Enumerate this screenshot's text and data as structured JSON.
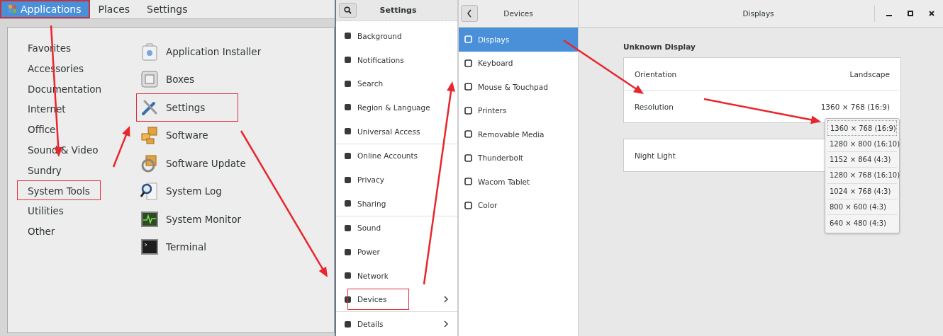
{
  "top_bar": {
    "menus": [
      {
        "label": "Applications",
        "selected": true,
        "highlighted": true
      },
      {
        "label": "Places",
        "selected": false,
        "highlighted": false
      },
      {
        "label": "Settings",
        "selected": false,
        "highlighted": false
      }
    ]
  },
  "app_menu": {
    "categories": [
      {
        "label": "Favorites",
        "highlighted": false
      },
      {
        "label": "Accessories",
        "highlighted": false
      },
      {
        "label": "Documentation",
        "highlighted": false
      },
      {
        "label": "Internet",
        "highlighted": false
      },
      {
        "label": "Office",
        "highlighted": false
      },
      {
        "label": "Sound & Video",
        "highlighted": false
      },
      {
        "label": "Sundry",
        "highlighted": false
      },
      {
        "label": "System Tools",
        "highlighted": true
      },
      {
        "label": "Utilities",
        "highlighted": false
      },
      {
        "label": "Other",
        "highlighted": false
      }
    ],
    "apps": [
      {
        "label": "Application Installer",
        "highlighted": false
      },
      {
        "label": "Boxes",
        "highlighted": false
      },
      {
        "label": "Settings",
        "highlighted": true
      },
      {
        "label": "Software",
        "highlighted": false
      },
      {
        "label": "Software Update",
        "highlighted": false
      },
      {
        "label": "System Log",
        "highlighted": false
      },
      {
        "label": "System Monitor",
        "highlighted": false
      },
      {
        "label": "Terminal",
        "highlighted": false
      }
    ]
  },
  "settings_panel": {
    "title": "Settings",
    "sections": [
      {
        "items": [
          {
            "label": "Background",
            "has_submenu": false,
            "highlighted": false
          },
          {
            "label": "Notifications",
            "has_submenu": false,
            "highlighted": false
          },
          {
            "label": "Search",
            "has_submenu": false,
            "highlighted": false
          },
          {
            "label": "Region & Language",
            "has_submenu": false,
            "highlighted": false
          },
          {
            "label": "Universal Access",
            "has_submenu": false,
            "highlighted": false
          }
        ]
      },
      {
        "items": [
          {
            "label": "Online Accounts",
            "has_submenu": false,
            "highlighted": false
          },
          {
            "label": "Privacy",
            "has_submenu": false,
            "highlighted": false
          },
          {
            "label": "Sharing",
            "has_submenu": false,
            "highlighted": false
          }
        ]
      },
      {
        "items": [
          {
            "label": "Sound",
            "has_submenu": false,
            "highlighted": false
          },
          {
            "label": "Power",
            "has_submenu": false,
            "highlighted": false
          },
          {
            "label": "Network",
            "has_submenu": false,
            "highlighted": false
          },
          {
            "label": "Devices",
            "has_submenu": true,
            "highlighted": true
          }
        ]
      },
      {
        "items": [
          {
            "label": "Details",
            "has_submenu": true,
            "highlighted": false
          }
        ]
      }
    ]
  },
  "devices_window": {
    "sidebar_title": "Devices",
    "title": "Displays",
    "sidebar_items": [
      {
        "label": "Displays",
        "selected": true
      },
      {
        "label": "Keyboard",
        "selected": false
      },
      {
        "label": "Mouse & Touchpad",
        "selected": false
      },
      {
        "label": "Printers",
        "selected": false
      },
      {
        "label": "Removable Media",
        "selected": false
      },
      {
        "label": "Thunderbolt",
        "selected": false
      },
      {
        "label": "Wacom Tablet",
        "selected": false
      },
      {
        "label": "Color",
        "selected": false
      }
    ],
    "section_title": "Unknown Display",
    "display_rows": [
      {
        "label": "Orientation",
        "value": "Landscape"
      },
      {
        "label": "Resolution",
        "value": "1360 × 768 (16:9)"
      }
    ],
    "night_light": {
      "label": "Night Light"
    },
    "resolution_options": [
      {
        "label": "1360 × 768 (16:9)",
        "selected": true
      },
      {
        "label": "1280 × 800 (16:10)",
        "selected": false
      },
      {
        "label": "1152 × 864 (4:3)",
        "selected": false
      },
      {
        "label": "1280 × 768 (16:10)",
        "selected": false
      },
      {
        "label": "1024 × 768 (4:3)",
        "selected": false
      },
      {
        "label": "800 × 600 (4:3)",
        "selected": false
      },
      {
        "label": "640 × 480 (4:3)",
        "selected": false
      }
    ]
  }
}
